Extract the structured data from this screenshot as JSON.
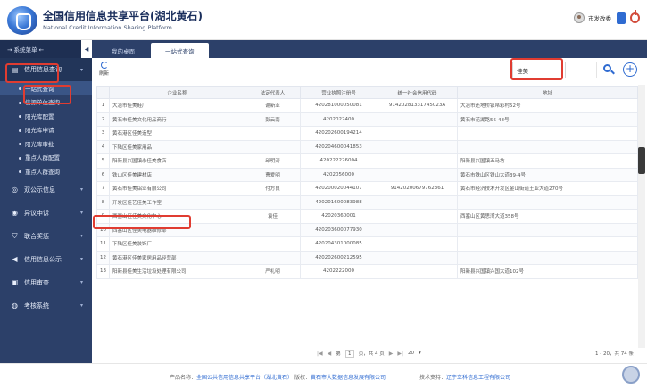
{
  "header": {
    "title": "全国信用信息共享平台(湖北黄石)",
    "subtitle": "National Credit Information Sharing Platform",
    "user_name": "市发改委"
  },
  "sidebar": {
    "title": "→ 系统菜单 ←",
    "collapse_label": "◀",
    "groups": [
      {
        "label": "信用信息查询",
        "icon": "book-icon"
      },
      {
        "label": "双公示信息",
        "icon": "globe-icon"
      },
      {
        "label": "异议申诉",
        "icon": "alert-icon"
      },
      {
        "label": "联合奖惩",
        "icon": "shield-icon"
      },
      {
        "label": "信用信息公示",
        "icon": "megaphone-icon"
      },
      {
        "label": "信用审查",
        "icon": "stamp-icon"
      },
      {
        "label": "考核系统",
        "icon": "target-icon"
      }
    ],
    "sub_items": [
      "一站式查询",
      "信源单位查询",
      "阳光库配置",
      "阳光库申请",
      "阳光库审批",
      "重点人群配置",
      "重点人群查询"
    ]
  },
  "tabs": [
    "我的桌面",
    "一站式查询"
  ],
  "toolbar": {
    "refresh_label": "刷新",
    "search_value": "佳美",
    "add_label": "+"
  },
  "table": {
    "columns": [
      "",
      "企业名称",
      "法定代表人",
      "营业执照注册号",
      "统一社会信用代码",
      "地址"
    ],
    "rows": [
      [
        "1",
        "大冶市佳美鞋厂",
        "谢新亚",
        "420281000050081",
        "91420281331745023A",
        "大冶市还地桥镇帛彩村52号"
      ],
      [
        "2",
        "黄石市佳美文化用品商行",
        "彭云南",
        "4202022400",
        "",
        "黄石市花湖路56-48号"
      ],
      [
        "3",
        "黄石港区佳美造型",
        "",
        "420202600194214",
        "",
        ""
      ],
      [
        "4",
        "下陆区佳美家用品",
        "",
        "420204600041853",
        "",
        ""
      ],
      [
        "5",
        "阳新县兴国镇永佳美食店",
        "邱明涛",
        "420222226004",
        "",
        "阳新县兴国镇五马坊"
      ],
      [
        "6",
        "铁山区佳美建材店",
        "曹爱明",
        "4202056000",
        "",
        "黄石市铁山区铁山大道39-4号"
      ],
      [
        "7",
        "黄石市佳美铝业有限公司",
        "付方良",
        "420200020044107",
        "91420200679762361",
        "黄石市经济技术开发区金山街道王亚大道270号"
      ],
      [
        "8",
        "开发区佳艺佳美工作室",
        "",
        "420201600083988",
        "",
        ""
      ],
      [
        "9",
        "西塞山区佳美文化中心",
        "袁佳",
        "42020360001",
        "",
        "西塞山区黄思湾大道358号"
      ],
      [
        "10",
        "西塞山区佳美电器维修部",
        "",
        "420203600077930",
        "",
        ""
      ],
      [
        "11",
        "下陆区佳美装饰厂",
        "",
        "420204301000085",
        "",
        ""
      ],
      [
        "12",
        "黄石港区佳美家居用品经营部",
        "",
        "420202600212595",
        "",
        ""
      ],
      [
        "13",
        "阳新县佳美生活垃圾处理有限公司",
        "严礼明",
        "4202222000",
        "",
        "阳新县兴国镇兴国大道102号"
      ]
    ]
  },
  "pager": {
    "first": "|◀",
    "prev": "◀",
    "page_prefix": "第",
    "page_value": "1",
    "page_suffix": "页，共 4 页",
    "next": "▶",
    "last": "▶|",
    "page_size": "20",
    "range": "1 - 20，共 74 条"
  },
  "footer": {
    "product_label": "产品名称：",
    "product_value": "全国公共信用信息共享平台（湖北黄石）",
    "copyright_label": "版权：",
    "copyright_value": "黄石市大数据信息发展有限公司",
    "support_label": "技术支持：",
    "support_value": "辽宁立科信息工程有限公司"
  }
}
